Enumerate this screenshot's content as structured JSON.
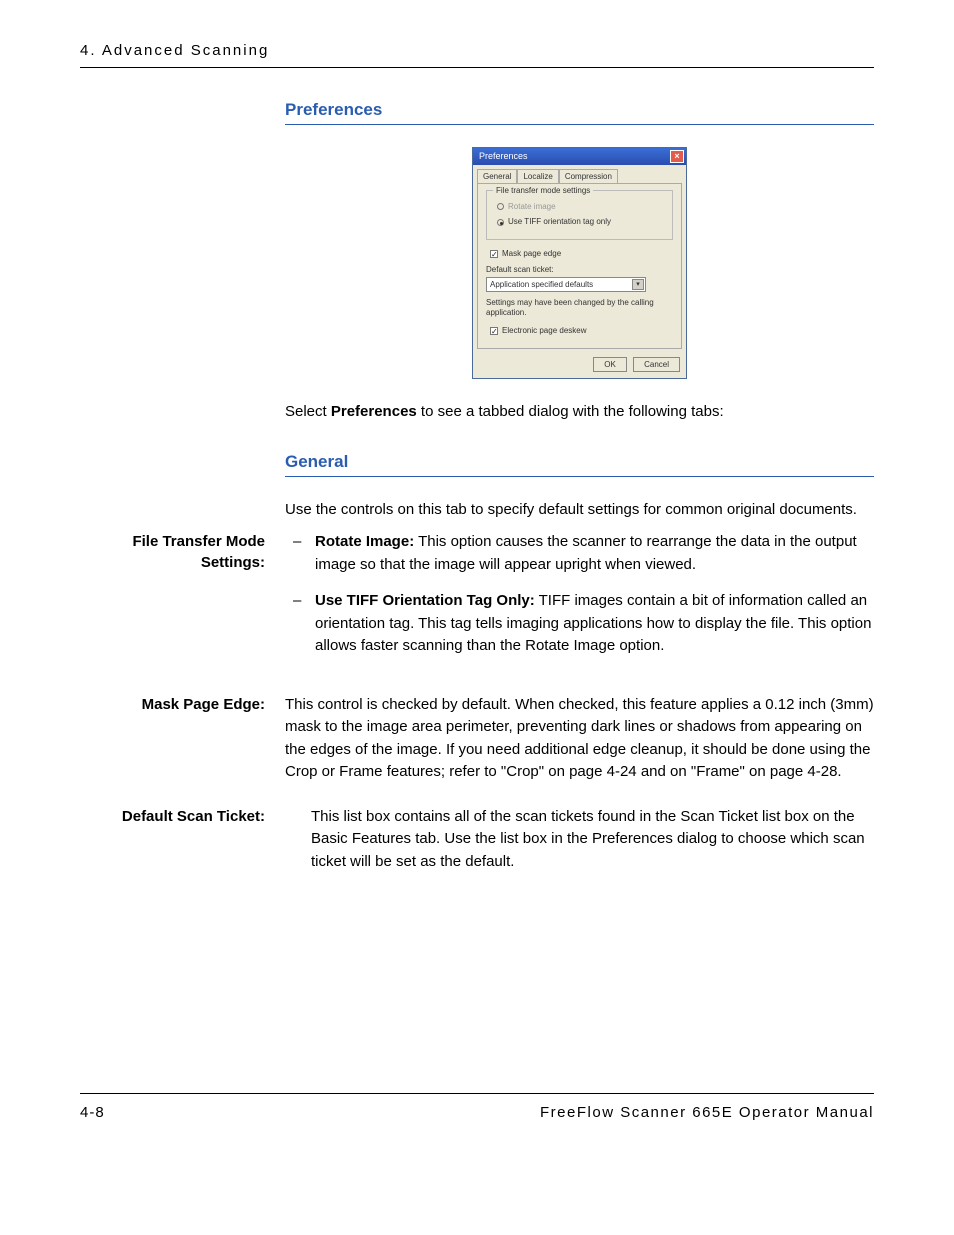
{
  "header": {
    "chapter": "4. Advanced Scanning"
  },
  "headings": {
    "preferences": "Preferences",
    "general": "General"
  },
  "dialog": {
    "title": "Preferences",
    "close_glyph": "×",
    "tabs": {
      "general": "General",
      "localize": "Localize",
      "compression": "Compression"
    },
    "fieldset_legend": "File transfer mode settings",
    "radio_rotate": "Rotate image",
    "radio_tiff": "Use TIFF orientation tag only",
    "chk_mask": "Mask page edge",
    "default_ticket_label": "Default scan ticket:",
    "combo_value": "Application specified defaults",
    "combo_arrow": "▾",
    "hint": "Settings may have been changed by the calling application.",
    "chk_deskew": "Electronic page deskew",
    "ok": "OK",
    "cancel": "Cancel",
    "checkmark": "✓"
  },
  "intro": {
    "select_prefix": "Select ",
    "select_bold": "Preferences",
    "select_suffix": " to see a tabbed dialog with the following tabs:"
  },
  "general_intro": "Use the controls on this tab to specify default settings for common original documents.",
  "ftms": {
    "label": "File Transfer Mode Settings:",
    "rotate_bold": "Rotate Image:",
    "rotate_text": "  This option causes the scanner to rearrange the data in the output image so that the image will appear upright when viewed.",
    "tiff_bold": "Use TIFF Orientation Tag Only:",
    "tiff_text": "  TIFF images contain a bit of information called an orientation tag. This tag tells imaging applications how to display the file.  This option allows faster scanning than the Rotate Image option."
  },
  "mask": {
    "label": "Mask Page Edge:",
    "text": "This control is checked by default. When checked, this feature applies a 0.12 inch (3mm) mask to the image area perimeter, preventing dark lines or shadows from appearing on the edges of the image.  If you need additional edge cleanup, it should be done using the Crop or Frame features; refer to \"Crop\" on page 4-24 and on \"Frame\" on page 4-28."
  },
  "ticket": {
    "label": "Default Scan Ticket:",
    "text": "This list box contains all of the scan tickets found in the Scan Ticket list box on the Basic Features tab.  Use the list box in the Preferences dialog to choose which scan ticket will be set as the default."
  },
  "footer": {
    "page": "4-8",
    "manual": "FreeFlow Scanner 665E Operator Manual"
  }
}
